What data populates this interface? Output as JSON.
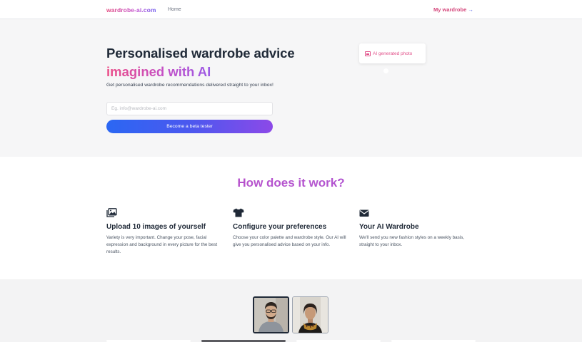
{
  "nav": {
    "brand": "wardrobe-ai.com",
    "home": "Home",
    "my_wardrobe": "My wardrobe",
    "my_wardrobe_arrow": "→"
  },
  "hero": {
    "title_line1": "Personalised wardrobe advice",
    "title_line2": "imagined with AI",
    "subtitle": "Get personalised wardrobe recommendations delivered straight to your inbox!",
    "email_placeholder": "Eg. info@wardrobe-ai.com",
    "email_value": "",
    "cta_label": "Become a beta tester",
    "photo_badge": "AI generated photo"
  },
  "how": {
    "title": "How does it work?",
    "steps": [
      {
        "icon": "images-icon",
        "title": "Upload 10 images of yourself",
        "desc": "Variety is very important. Change your pose, facial expression and background in every picture for the best results."
      },
      {
        "icon": "tshirt-icon",
        "title": "Configure your preferences",
        "desc": "Choose your color palette and wardrobe style. Our AI will give you personalised advice based on your info."
      },
      {
        "icon": "envelope-icon",
        "title": "Your AI Wardrobe",
        "desc": "We'll send you new fashion styles on a weekly basis, straight to your inbox."
      }
    ]
  },
  "gallery": {
    "thumbnails": [
      {
        "name": "man-with-glasses-photo",
        "selected": true
      },
      {
        "name": "woman-with-scarf-photo",
        "selected": false
      }
    ]
  },
  "colors": {
    "brand_pink": "#e3477c",
    "brand_purple": "#c44fc6",
    "brand_blue": "#2b67f3"
  }
}
